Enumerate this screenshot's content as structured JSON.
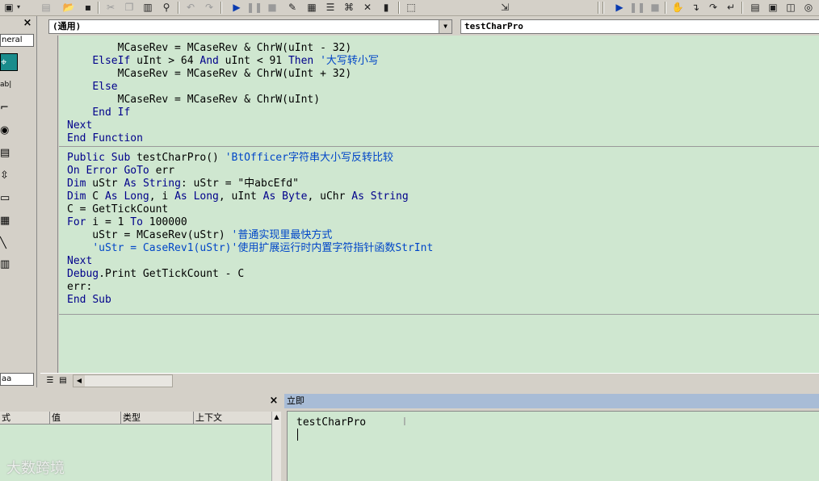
{
  "toolbar": {
    "icons": [
      "vba-project-icon",
      "dropdown-icon",
      "new-module-icon",
      "open-icon",
      "save-icon",
      "cut-icon",
      "copy-icon",
      "paste-icon",
      "find-icon",
      "undo-icon",
      "redo-icon",
      "run-icon",
      "break-icon",
      "reset-icon",
      "design-mode-icon",
      "project-explorer-icon",
      "properties-icon",
      "object-browser-icon",
      "toolbox-icon",
      "help-icon"
    ]
  },
  "toolbox": {
    "close_label": "×",
    "tab_label": "neral",
    "bottom_label": "aa"
  },
  "code_window": {
    "object_combo": "(通用)",
    "procedure_combo": "testCharPro"
  },
  "code_lines": [
    "        MCaseRev = MCaseRev & ChrW(uInt - 32)",
    "    ElseIf uInt > 64 And uInt < 91 Then '大写转小写",
    "        MCaseRev = MCaseRev & ChrW(uInt + 32)",
    "    Else",
    "        MCaseRev = MCaseRev & ChrW(uInt)",
    "    End If",
    "Next",
    "End Function",
    "Public Sub testCharPro() 'BtOfficer字符串大小写反转比较",
    "On Error GoTo err",
    "Dim uStr As String: uStr = \"中abcEfd\"",
    "Dim C As Long, i As Long, uInt As Byte, uChr As String",
    "C = GetTickCount",
    "For i = 1 To 100000",
    "    uStr = MCaseRev(uStr) '普通实现里最快方式",
    "    'uStr = CaseRev1(uStr)'使用扩展运行时内置字符指针函数StrInt",
    "Next",
    "Debug.Print GetTickCount - C",
    "err:",
    "End Sub"
  ],
  "locals": {
    "close_label": "×",
    "columns": [
      "式",
      "值",
      "类型",
      "上下文"
    ]
  },
  "immediate": {
    "title": "立即",
    "lines": [
      "testCharPro"
    ]
  },
  "watermark": "大数跨境"
}
